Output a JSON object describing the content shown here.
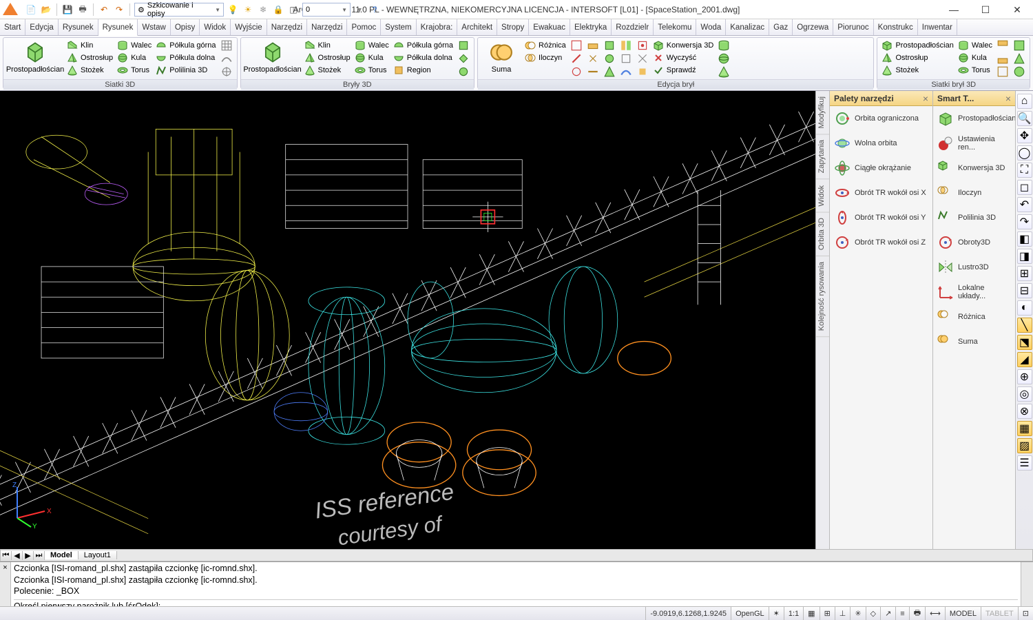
{
  "title": "ArCADia PLUS 11.0 PL - WEWNĘTRZNA, NIEKOMERCYJNA LICENCJA - INTERSOFT [L01] - [SpaceStation_2001.dwg]",
  "qat": {
    "combo1": "Szkicowanie i opisy",
    "combo2": "0"
  },
  "tabs": [
    "Start",
    "Edycja",
    "Rysunek",
    "Rysunek",
    "Wstaw",
    "Opisy",
    "Widok",
    "Wyjście",
    "Narzędzi",
    "Narzędzi",
    "Pomoc",
    "System",
    "Krajobra:",
    "Architekt",
    "Stropy",
    "Ewakuac",
    "Elektryka",
    "Rozdzielr",
    "Telekomu",
    "Woda",
    "Kanalizac",
    "Gaz",
    "Ogrzewa",
    "Piorunoc",
    "Konstrukc",
    "Inwentar"
  ],
  "active_tab_index": 3,
  "panels": {
    "siatki3d": {
      "title": "Siatki 3D",
      "big": "Prostopadłościan",
      "items": [
        "Klin",
        "Ostrosłup",
        "Stożek",
        "Walec",
        "Kula",
        "Torus",
        "Półkula górna",
        "Półkula dolna",
        "Polilinia 3D"
      ]
    },
    "bryly3d": {
      "title": "Bryły 3D",
      "big": "Prostopadłościan",
      "items": [
        "Klin",
        "Ostrosłup",
        "Stożek",
        "Walec",
        "Kula",
        "Torus",
        "Półkula górna",
        "Półkula dolna",
        "Region"
      ]
    },
    "edycja": {
      "title": "Edycja brył",
      "big": "Suma",
      "items": [
        "Różnica",
        "Iloczyn",
        "Konwersja 3D",
        "Wyczyść",
        "Sprawdź"
      ]
    },
    "siatkibryl": {
      "title": "Siatki brył 3D",
      "items": [
        "Prostopadłościan",
        "Ostrosłup",
        "Stożek",
        "Walec",
        "Kula",
        "Torus"
      ]
    }
  },
  "vtabs": [
    "Modyfikuj",
    "Zapytania",
    "Widok",
    "Orbita 3D",
    "Kolejność rysowania"
  ],
  "palette1": {
    "title": "Palety narzędzi",
    "items": [
      "Orbita ograniczona",
      "Wolna orbita",
      "Ciągłe okrążanie",
      "Obrót TR wokół osi X",
      "Obrót TR wokół osi Y",
      "Obrót TR wokół osi Z"
    ]
  },
  "palette2": {
    "title": "Smart T...",
    "items": [
      "Prostopadłościan",
      "Ustawienia ren...",
      "Konwersja 3D",
      "Iloczyn",
      "Polilinia 3D",
      "Obroty3D",
      "Lustro3D",
      "Lokalne układy...",
      "Różnica",
      "Suma"
    ]
  },
  "model_tabs": [
    "Model",
    "Layout1"
  ],
  "cmd": {
    "line1": "Czcionka [ISI-romand_pl.shx] zastąpiła czcionkę [ic-romnd.shx].",
    "line2": "Czcionka [ISI-romand_pl.shx] zastąpiła czcionkę [ic-romnd.shx].",
    "line3": "Polecenie: _BOX",
    "prompt": "Określ pierwszy narożnik lub [śrOdek]:"
  },
  "status": {
    "coords": "-9.0919,6.1268,1.9245",
    "render": "OpenGL",
    "scale": "1:1",
    "model": "MODEL",
    "tablet": "TABLET"
  },
  "canvas_text": {
    "line1": "ISS reference",
    "line2": "courtesy of"
  }
}
